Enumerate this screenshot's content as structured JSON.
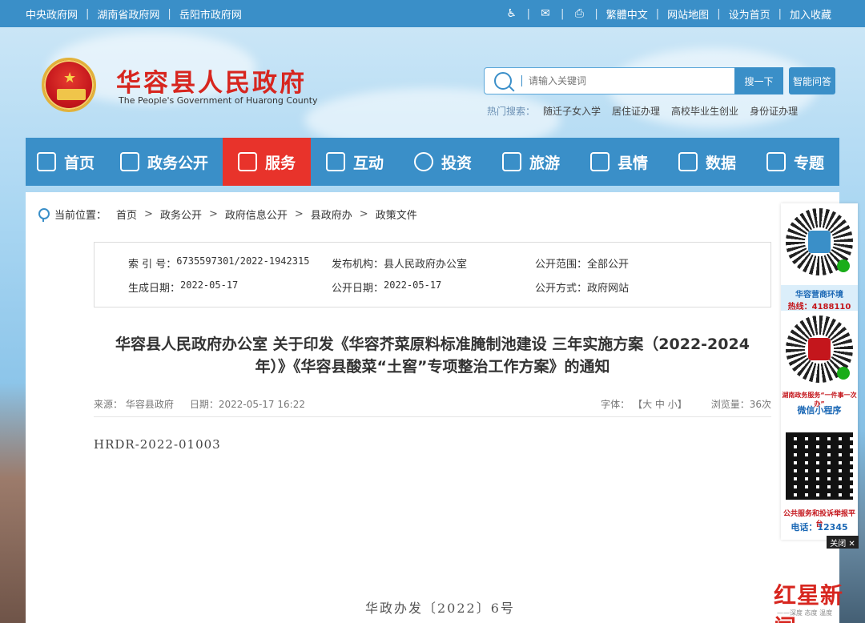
{
  "topbar": {
    "links": [
      "中央政府网",
      "湖南省政府网",
      "岳阳市政府网"
    ],
    "right_links": [
      "繁體中文",
      "网站地图",
      "设为首页",
      "加入收藏"
    ]
  },
  "header": {
    "title": "华容县人民政府",
    "subtitle": "The People's Government of Huarong County",
    "search_placeholder": "请输入关键词",
    "search_button": "搜一下",
    "ai_button": "智能问答",
    "hot_label": "热门搜索：",
    "hot_items": [
      "随迁子女入学",
      "居住证办理",
      "高校毕业生创业",
      "身份证办理"
    ]
  },
  "nav": {
    "items": [
      "首页",
      "政务公开",
      "服务",
      "互动",
      "投资",
      "旅游",
      "县情",
      "数据",
      "专题"
    ],
    "active_index": 2,
    "active_color": "#e8332b",
    "bar_color": "#3a8fc8"
  },
  "breadcrumb": {
    "label": "当前位置：",
    "items": [
      "首页",
      "政务公开",
      "政府信息公开",
      "县政府办",
      "政策文件"
    ]
  },
  "meta": {
    "index_label": "索 引 号：",
    "index_value": "6735597301/2022-1942315",
    "publisher_label": "发布机构：",
    "publisher_value": "县人民政府办公室",
    "scope_label": "公开范围：",
    "scope_value": "全部公开",
    "created_label": "生成日期：",
    "created_value": "2022-05-17",
    "public_date_label": "公开日期：",
    "public_date_value": "2022-05-17",
    "method_label": "公开方式：",
    "method_value": "政府网站"
  },
  "article": {
    "title_line1": "华容县人民政府办公室 关于印发《华容芥菜原料标准腌制池建设 三年实施方案（2022-2024",
    "title_line2": "年）》《华容县酸菜“土窖”专项整治工作方案》的通知",
    "source": "来源：  华容县政府",
    "date": "日期：2022-05-17 16:22",
    "font_label": "字体：",
    "font_sizes": "【大  中  小】",
    "views": "浏览量：36次",
    "doc_code": "HRDR-2022-01003",
    "doc_number": "华政办发〔2022〕6号"
  },
  "float_panel": {
    "qr1_caption_line1": "华容营商环境",
    "qr1_caption_line2": "热线：4188110",
    "qr2_caption_line1": "湖南政务服务“一件事一次办”",
    "qr2_caption_line2": "微信小程序",
    "qr3_caption_line1": "公共服务和投诉举报平台",
    "qr3_caption_line2": "电话：12345",
    "close_label": "关闭 ✕"
  },
  "watermark": {
    "text": "红星新闻",
    "sub": "——深度 态度 温度"
  }
}
